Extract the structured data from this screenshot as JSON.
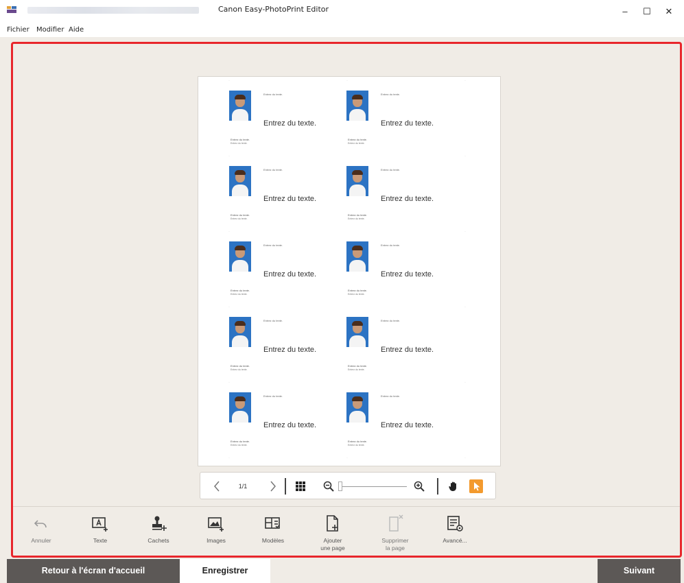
{
  "window": {
    "title": "Canon Easy-PhotoPrint Editor",
    "controls": {
      "minimize": "–",
      "maximize": "☐",
      "close": "✕"
    }
  },
  "menu": [
    "Fichier",
    "Modifier",
    "Aide"
  ],
  "cards": {
    "small_text": "Entrez du texte.",
    "big_text": "Entrez du texte.",
    "footer_line1": "Entrez du texte.",
    "footer_line2": "Entrez du texte."
  },
  "navigation": {
    "prev_icon": "chevron-left-icon",
    "page_indicator": "1/1",
    "next_icon": "chevron-right-icon",
    "grid_icon": "grid-icon",
    "zoom_out_icon": "zoom-out-icon",
    "zoom_in_icon": "zoom-in-icon",
    "zoom_level": 0.05,
    "pan_icon": "hand-icon",
    "select_icon": "pointer-icon",
    "accent_color": "#f39a2e"
  },
  "tools": [
    {
      "label": "Annuler",
      "icon": "undo-icon",
      "enabled": false
    },
    {
      "label": "Texte",
      "icon": "add-text-icon",
      "enabled": true
    },
    {
      "label": "Cachets",
      "icon": "stamp-icon",
      "enabled": true
    },
    {
      "label": "Images",
      "icon": "image-icon",
      "enabled": true
    },
    {
      "label": "Modèles",
      "icon": "templates-icon",
      "enabled": true
    },
    {
      "label": "Ajouter\nune page",
      "icon": "add-page-icon",
      "enabled": true
    },
    {
      "label": "Supprimer\nla page",
      "icon": "delete-page-icon",
      "enabled": false
    },
    {
      "label": "Avancé...",
      "icon": "advanced-icon",
      "enabled": true
    }
  ],
  "bottom": {
    "home_button": "Retour à l'écran d'accueil",
    "save_button": "Enregistrer",
    "next_button": "Suivant"
  },
  "colors": {
    "highlight": "#e8262c",
    "button_dark": "#5c5856",
    "background": "#f0ece6"
  }
}
